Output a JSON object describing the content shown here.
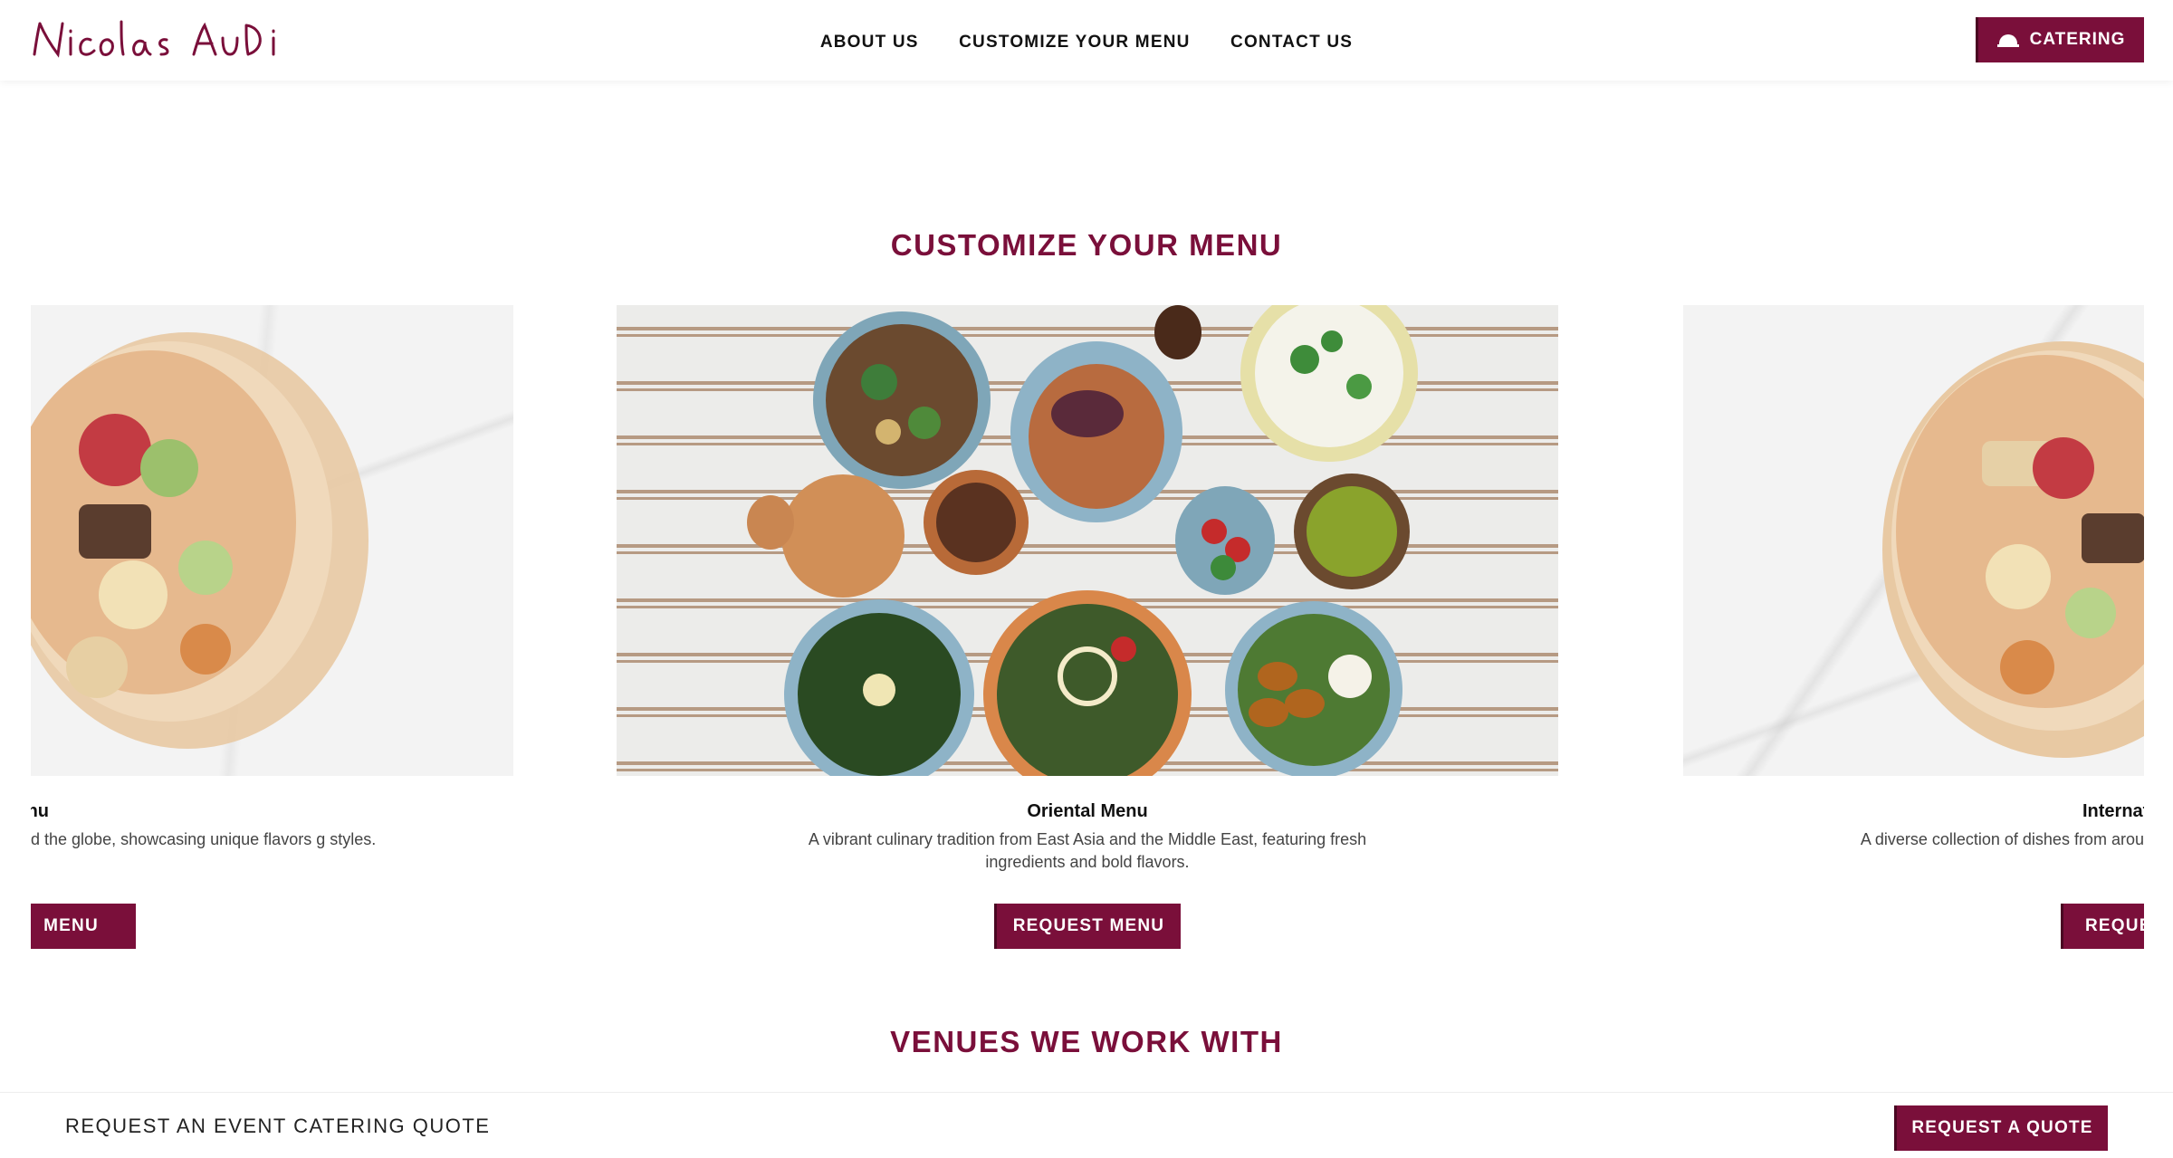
{
  "header": {
    "logo_text": "Nicolas Audi",
    "nav": [
      "ABOUT US",
      "CUSTOMIZE YOUR MENU",
      "CONTACT US"
    ],
    "catering_label": "CATERING",
    "catering_icon": "cloche-icon"
  },
  "customize": {
    "title": "CUSTOMIZE YOUR MENU",
    "cards": [
      {
        "name": "nal Menu",
        "desc": "d the globe, showcasing unique flavors g styles.",
        "button": "MENU"
      },
      {
        "name": "Oriental Menu",
        "desc": "A vibrant culinary tradition from East Asia and the Middle East, featuring fresh ingredients and bold flavors.",
        "button": "REQUEST MENU"
      },
      {
        "name": "Internati",
        "desc": "A diverse collection of dishes from arou and coo",
        "button": "REQUE"
      }
    ]
  },
  "venues": {
    "title": "VENUES WE WORK WITH"
  },
  "bottom_bar": {
    "text": "REQUEST AN EVENT CATERING QUOTE",
    "button": "REQUEST A QUOTE"
  },
  "colors": {
    "brand": "#7a0f3a",
    "text": "#111111",
    "muted": "#444444"
  }
}
